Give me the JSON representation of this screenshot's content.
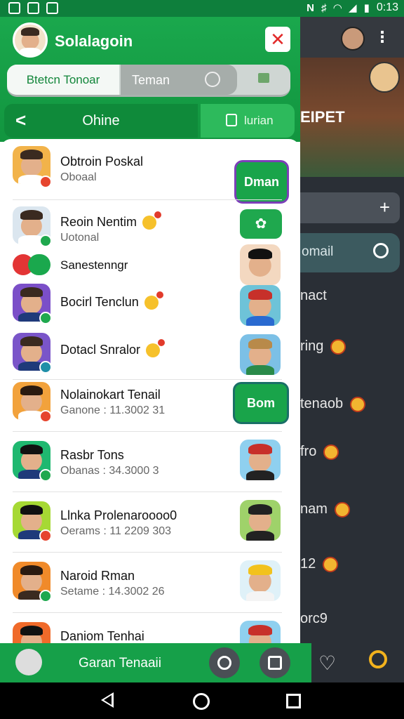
{
  "status_bar": {
    "time": "0:13",
    "left_icons": [
      "image-icon",
      "app-icon",
      "app-icon"
    ],
    "right_icons": [
      "nfc-icon",
      "vibrate-icon",
      "wifi-icon",
      "signal-icon",
      "battery-icon"
    ]
  },
  "background_app": {
    "banner_text": "EIPET",
    "search_text": "omail",
    "items": [
      "nact",
      "ring",
      "tenaob",
      "fro",
      "nam",
      "12",
      "orc9"
    ]
  },
  "header": {
    "title": "Solalagoin",
    "close_symbol": "✕"
  },
  "tabs": [
    {
      "label": "Btetcn Tonoar"
    },
    {
      "label": "Teman"
    }
  ],
  "nav": {
    "back_symbol": "<",
    "label": "Ohine",
    "right_label": "lurian"
  },
  "contacts": [
    {
      "name": "Obtroin Poskal",
      "sub": "Oboaal",
      "action": "Dman",
      "avatar_bg": "#f2b34a",
      "badge": "#e6452e"
    },
    {
      "name": "Reoin Nentim",
      "sub": "Uotonal",
      "action": "",
      "avatar_bg": "#dbe6ef",
      "badge": "#1fa84e",
      "emoji": true
    },
    {
      "name": "Sanestenngr",
      "sub": "",
      "action": "",
      "avatar_bg": "",
      "badge": ""
    },
    {
      "name": "Bocirl Tenclun",
      "sub": "",
      "action": "",
      "avatar_bg": "#7b4fc8",
      "badge": "#1fa84e",
      "emoji": true
    },
    {
      "name": "Dotacl Snralor",
      "sub": "",
      "action": "",
      "avatar_bg": "#7a55c9",
      "badge": "#1f8fa8",
      "emoji": true
    },
    {
      "name": "Nolainokart Tenail",
      "sub": "Ganone : 11.3002 31",
      "action": "Bom",
      "avatar_bg": "#f2a23c",
      "badge": "#e6452e"
    },
    {
      "name": "Rasbr Tons",
      "sub": "Obanas : 34.3000 3",
      "action": "",
      "avatar_bg": "#1fb870",
      "badge": "#1fa84e"
    },
    {
      "name": "Llnka Prolenaroooo0",
      "sub": "Oerams : 11 2209 303",
      "action": "",
      "avatar_bg": "#a6d934",
      "badge": "#e6452e"
    },
    {
      "name": "Naroid Rman",
      "sub": "Setame : 14.3002 26",
      "action": "",
      "avatar_bg": "#f08a2a",
      "badge": "#1fa84e"
    },
    {
      "name": "Daniom Tenhai",
      "sub": "",
      "action": "",
      "avatar_bg": "#f06a2a",
      "badge": ""
    }
  ],
  "bottom_bar": {
    "label": "Garan Tenaaii"
  },
  "colors": {
    "primary_green": "#16a049",
    "dark_panel": "#2a2f36",
    "accent_purple": "#7b3fb8"
  }
}
